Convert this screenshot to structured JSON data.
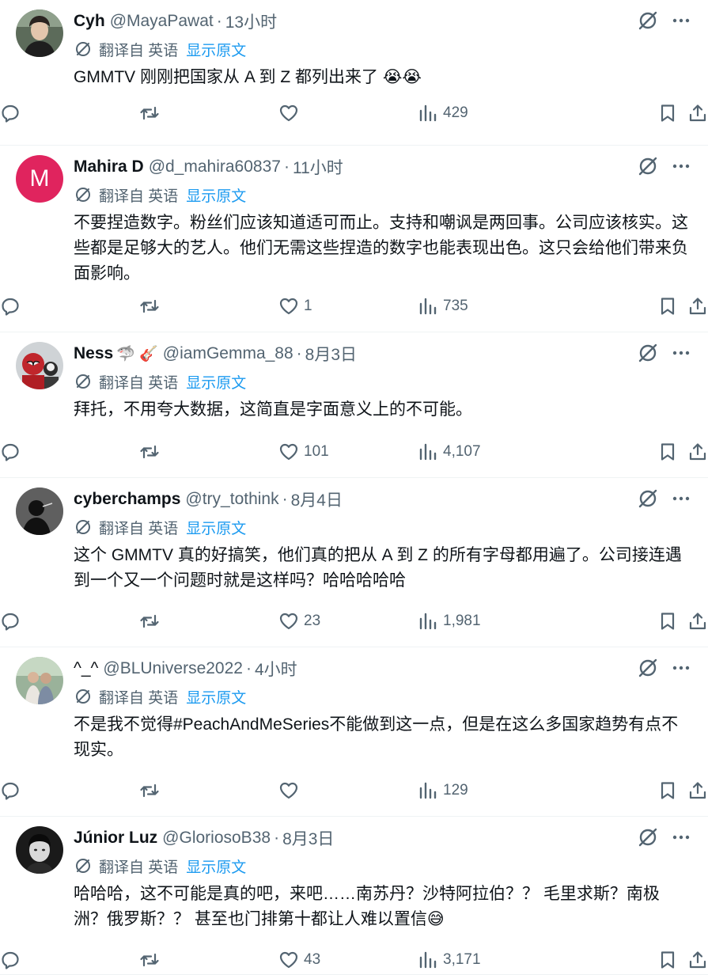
{
  "translate_label": "翻译自 英语",
  "show_original": "显示原文",
  "tweets": [
    {
      "name": "Cyh",
      "name_emoji": "",
      "handle": "@MayaPawat",
      "time": "13小时",
      "text": "GMMTV 刚刚把国家从 A 到 Z 都列出来了 😭😭",
      "replies": "",
      "retweets": "",
      "likes": "",
      "views": "429",
      "avatar": "photo-portrait"
    },
    {
      "name": "Mahira D",
      "name_emoji": "",
      "handle": "@d_mahira60837",
      "time": "11小时",
      "text": "不要捏造数字。粉丝们应该知道适可而止。支持和嘲讽是两回事。公司应该核实。这些都是足够大的艺人。他们无需这些捏造的数字也能表现出色。这只会给他们带来负面影响。",
      "replies": "",
      "retweets": "",
      "likes": "1",
      "views": "735",
      "avatar": "letter-m",
      "avatar_letter": "M",
      "avatar_color": "#e0245e"
    },
    {
      "name": "Ness",
      "name_emoji": "🦈 🎸",
      "handle": "@iamGemma_88",
      "time": "8月3日",
      "text": "拜托，不用夸大数据，这简直是字面意义上的不可能。",
      "replies": "",
      "retweets": "",
      "likes": "101",
      "views": "4,107",
      "avatar": "photo-superhero"
    },
    {
      "name": "cyberchamps",
      "name_emoji": "",
      "handle": "@try_tothink",
      "time": "8月4日",
      "text": "这个 GMMTV 真的好搞笑，他们真的把从 A 到 Z 的所有字母都用遍了。公司接连遇到一个又一个问题时就是这样吗？哈哈哈哈哈",
      "replies": "",
      "retweets": "",
      "likes": "23",
      "views": "1,981",
      "avatar": "photo-silhouette"
    },
    {
      "name": "^_^",
      "name_emoji": "",
      "handle": "@BLUniverse2022",
      "time": "4小时",
      "text": "不是我不觉得#PeachAndMeSeries不能做到这一点，但是在这么多国家趋势有点不现实。",
      "replies": "",
      "retweets": "",
      "likes": "",
      "views": "129",
      "avatar": "photo-two-people",
      "name_normal": true
    },
    {
      "name": "Júnior Luz",
      "name_emoji": "",
      "handle": "@GloriosoB38",
      "time": "8月3日",
      "text": "哈哈哈，这不可能是真的吧，来吧……南苏丹？沙特阿拉伯？？ 毛里求斯？南极洲？俄罗斯？？ 甚至也门排第十都让人难以置信😅",
      "replies": "",
      "retweets": "",
      "likes": "43",
      "views": "3,171",
      "avatar": "photo-bw-portrait"
    }
  ]
}
